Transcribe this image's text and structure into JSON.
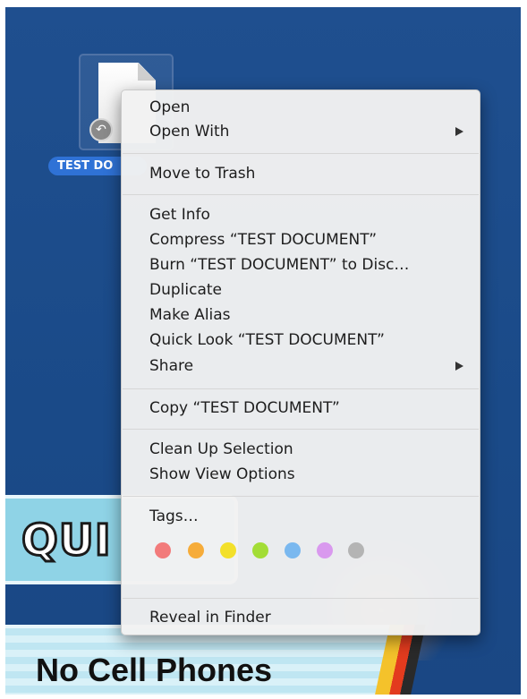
{
  "desktop": {
    "file": {
      "label": "TEST DO",
      "badge_icon": "alias-arrow-icon"
    },
    "sign_upper_text": "QUI",
    "sign_lower_text": "No Cell Phones"
  },
  "menu": {
    "open": "Open",
    "open_with": "Open With",
    "move_to_trash": "Move to Trash",
    "get_info": "Get Info",
    "compress": "Compress “TEST DOCUMENT”",
    "burn": "Burn “TEST DOCUMENT” to Disc…",
    "duplicate": "Duplicate",
    "make_alias": "Make Alias",
    "quick_look": "Quick Look “TEST DOCUMENT”",
    "share": "Share",
    "copy": "Copy “TEST DOCUMENT”",
    "clean_up": "Clean Up Selection",
    "view_options": "Show View Options",
    "tags": "Tags…",
    "reveal": "Reveal in Finder"
  },
  "tag_colors": [
    "#f27b7b",
    "#f6ac3a",
    "#f3e02a",
    "#a3dd36",
    "#7ab8ef",
    "#d999ee",
    "#b4b4b4"
  ],
  "colors": {
    "desktop": "#1c4d8c",
    "selection": "#2f72d6",
    "menu_bg": "#f2f2f2"
  }
}
